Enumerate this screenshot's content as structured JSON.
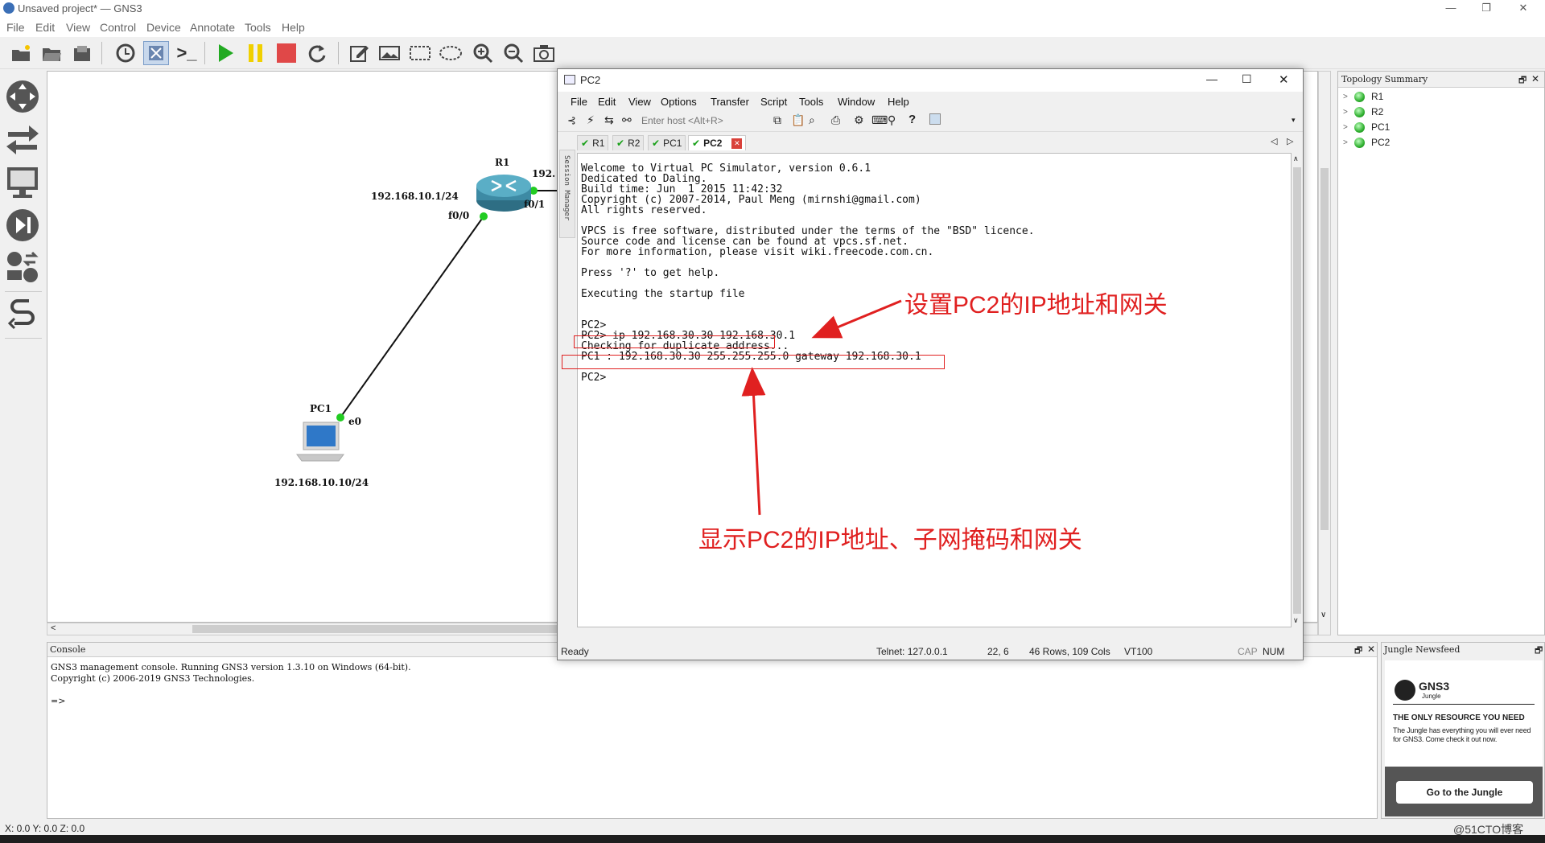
{
  "app": {
    "title": "Unsaved project* — GNS3"
  },
  "menubar": [
    "File",
    "Edit",
    "View",
    "Control",
    "Device",
    "Annotate",
    "Tools",
    "Help"
  ],
  "topology_nodes": [
    {
      "name": "R1",
      "label": "R1"
    },
    {
      "name": "PC1",
      "label": "PC1"
    }
  ],
  "canvas_labels": {
    "r1_ip": "192.168.10.1/24",
    "r1_f00": "f0/0",
    "r1_f01": "f0/1",
    "r1_right_ip": "192.",
    "pc1_e0": "e0",
    "pc1_ip": "192.168.10.10/24"
  },
  "topology_summary": {
    "title": "Topology Summary",
    "items": [
      "R1",
      "R2",
      "PC1",
      "PC2"
    ]
  },
  "console": {
    "title": "Console",
    "lines": "GNS3 management console. Running GNS3 version 1.3.10 on Windows (64-bit).\nCopyright (c) 2006-2019 GNS3 Technologies.\n\n=>"
  },
  "jungle": {
    "title": "Jungle Newsfeed",
    "brand": "GNS3",
    "brand_sub": "Jungle",
    "headline": "THE ONLY RESOURCE YOU NEED",
    "body": "The Jungle has everything you will ever need for GNS3. Come check it out now.",
    "button": "Go to the Jungle"
  },
  "statusbar": {
    "coords": "X: 0.0 Y: 0.0 Z: 0.0",
    "watermark": "@51CTO博客"
  },
  "pc2": {
    "title": "PC2",
    "menu": [
      "File",
      "Edit",
      "View",
      "Options",
      "Transfer",
      "Script",
      "Tools",
      "Window",
      "Help"
    ],
    "host_placeholder": "Enter host <Alt+R>",
    "tabs": [
      "R1",
      "R2",
      "PC1",
      "PC2"
    ],
    "session_manager": "Session Manager",
    "terminal": "Welcome to Virtual PC Simulator, version 0.6.1\nDedicated to Daling.\nBuild time: Jun  1 2015 11:42:32\nCopyright (c) 2007-2014, Paul Meng (mirnshi@gmail.com)\nAll rights reserved.\n\nVPCS is free software, distributed under the terms of the \"BSD\" licence.\nSource code and license can be found at vpcs.sf.net.\nFor more information, please visit wiki.freecode.com.cn.\n\nPress '?' to get help.\n\nExecuting the startup file\n\n\nPC2>\nPC2> ip 192.168.30.30 192.168.30.1\nChecking for duplicate address...\nPC1 : 192.168.30.30 255.255.255.0 gateway 192.168.30.1\n\nPC2>",
    "status": {
      "ready": "Ready",
      "telnet": "Telnet: 127.0.0.1",
      "pos": "22,   6",
      "size": "46 Rows, 109 Cols",
      "term": "VT100",
      "cap": "CAP",
      "num": "NUM"
    }
  },
  "annotations": {
    "set_ip": "设置PC2的IP地址和网关",
    "show_ip": "显示PC2的IP地址、子网掩码和网关"
  },
  "colors": {
    "annotation": "#e02020",
    "link_up": "#22cc22",
    "router": "#4a90a8"
  }
}
